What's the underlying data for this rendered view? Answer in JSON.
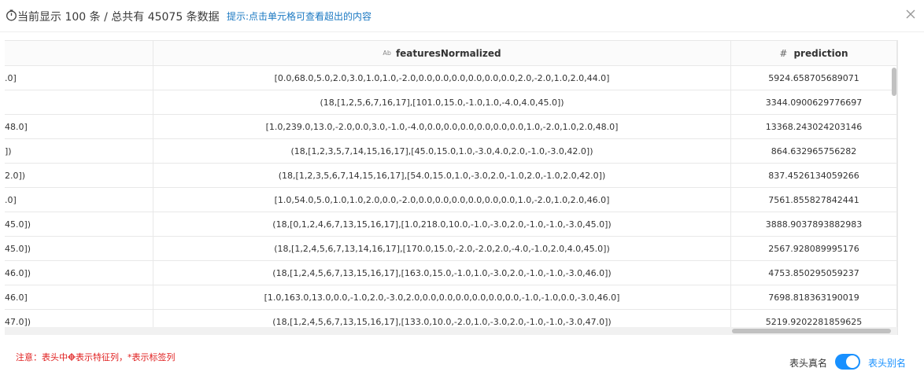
{
  "header": {
    "count_text": "当前显示 100 条 / 总共有 45075 条数据",
    "hint": "提示:点击单元格可查看超出的内容"
  },
  "table": {
    "columns": [
      {
        "label": ""
      },
      {
        "label": "featuresNormalized",
        "type_icon": "Ab"
      },
      {
        "label": "prediction",
        "type_icon": "#"
      }
    ],
    "rows": [
      [
        ".0]",
        "[0.0,68.0,5.0,2.0,3.0,1.0,1.0,-2.0,0.0,0.0,0.0,0.0,0.0,0.0,2.0,-2.0,1.0,2.0,44.0]",
        "5924.658705689071"
      ],
      [
        "",
        "(18,[1,2,5,6,7,16,17],[101.0,15.0,-1.0,1.0,-4.0,4.0,45.0])",
        "3344.0900629776697"
      ],
      [
        "48.0]",
        "[1.0,239.0,13.0,-2.0,0.0,3.0,-1.0,-4.0,0.0,0.0,0.0,0.0,0.0,0.0,1.0,-2.0,1.0,2.0,48.0]",
        "13368.243024203146"
      ],
      [
        "])",
        "(18,[1,2,3,5,7,14,15,16,17],[45.0,15.0,1.0,-3.0,4.0,2.0,-1.0,-3.0,42.0])",
        "864.632965756282"
      ],
      [
        "2.0])",
        "(18,[1,2,3,5,6,7,14,15,16,17],[54.0,15.0,1.0,-3.0,2.0,-1.0,2.0,-1.0,2.0,42.0])",
        "837.4526134059266"
      ],
      [
        ".0]",
        "[1.0,54.0,5.0,1.0,1.0,2.0,0.0,-2.0,0.0,0.0,0.0,0.0,0.0,0.0,1.0,-2.0,1.0,2.0,46.0]",
        "7561.855827842441"
      ],
      [
        "45.0])",
        "(18,[0,1,2,4,6,7,13,15,16,17],[1.0,218.0,10.0,-1.0,-3.0,2.0,-1.0,-1.0,-3.0,45.0])",
        "3888.9037893882983"
      ],
      [
        "45.0])",
        "(18,[1,2,4,5,6,7,13,14,16,17],[170.0,15.0,-2.0,-2.0,2.0,-4.0,-1.0,2.0,4.0,45.0])",
        "2567.928089995176"
      ],
      [
        "46.0])",
        "(18,[1,2,4,5,6,7,13,15,16,17],[163.0,15.0,-1.0,1.0,-3.0,2.0,-1.0,-1.0,-3.0,46.0])",
        "4753.850295059237"
      ],
      [
        "46.0]",
        "[1.0,163.0,13.0,0.0,-1.0,2.0,-3.0,2.0,0.0,0.0,0.0,0.0,0.0,0.0,-1.0,-1.0,0.0,-3.0,46.0]",
        "7698.818363190019"
      ],
      [
        "47.0])",
        "(18,[1,2,4,5,6,7,13,15,16,17],[133.0,10.0,-2.0,1.0,-3.0,2.0,-1.0,-1.0,-3.0,47.0])",
        "5219.9202281859625"
      ]
    ]
  },
  "footer": {
    "note_prefix": "注意：表头中",
    "note_suffix": "表示特征列，*表示标签列",
    "toggle_left": "表头真名",
    "toggle_right": "表头别名",
    "toggle_on": true,
    "accent_color": "#1890ff",
    "note_color": "#e02020"
  }
}
